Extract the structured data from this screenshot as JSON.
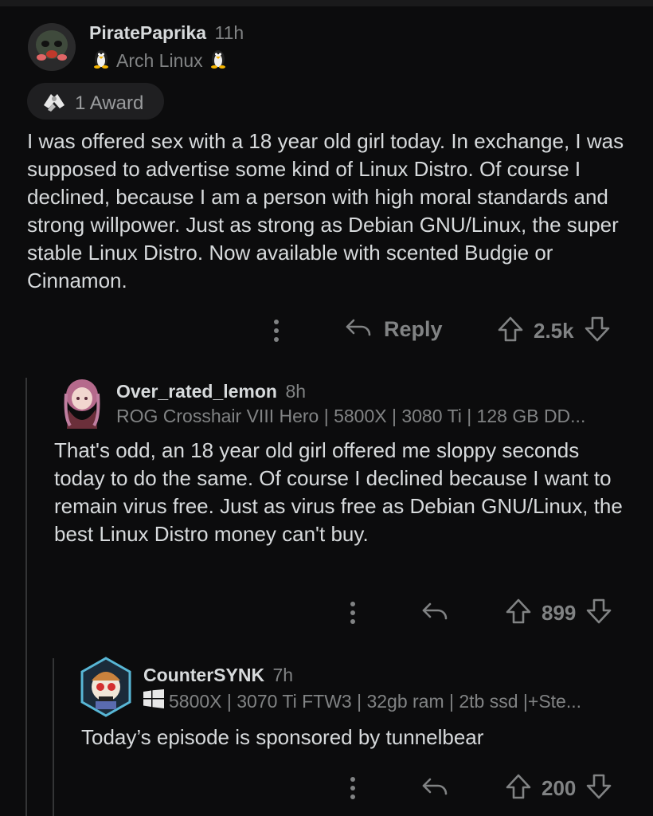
{
  "comments": [
    {
      "username": "PiratePaprika",
      "age": "11h",
      "flair": "Arch Linux",
      "award": "1 Award",
      "body": "I was offered sex with a 18 year old girl today. In exchange, I was supposed to advertise some kind of Linux Distro. Of course I declined, because I am a person with high moral standards and strong willpower. Just as strong as Debian GNU/Linux, the super stable Linux Distro. Now available with scented Budgie or Cinnamon.",
      "reply_label": "Reply",
      "votes": "2.5k"
    },
    {
      "username": "Over_rated_lemon",
      "age": "8h",
      "flair": "ROG Crosshair VIII Hero | 5800X | 3080 Ti | 128 GB DD...",
      "body": "That's odd, an 18 year old girl offered me sloppy seconds today to do the same. Of course I declined because I want to remain virus free. Just as virus free as Debian GNU/Linux, the best Linux Distro money can't buy.",
      "votes": "899"
    },
    {
      "username": "CounterSYNK",
      "age": "7h",
      "flair": "5800X | 3070 Ti FTW3 | 32gb ram | 2tb ssd |+Ste...",
      "body": "Today’s episode is sponsored by tunnelbear",
      "votes": "200"
    }
  ],
  "colors": {
    "background": "#0c0c0d",
    "text": "#d7dadc",
    "muted": "#818384",
    "thread_line": "#343536"
  },
  "icons": [
    "avatar-pirate",
    "penguin-icon",
    "award-icon",
    "more-icon",
    "reply-icon",
    "upvote-icon",
    "downvote-icon",
    "windows-icon"
  ]
}
